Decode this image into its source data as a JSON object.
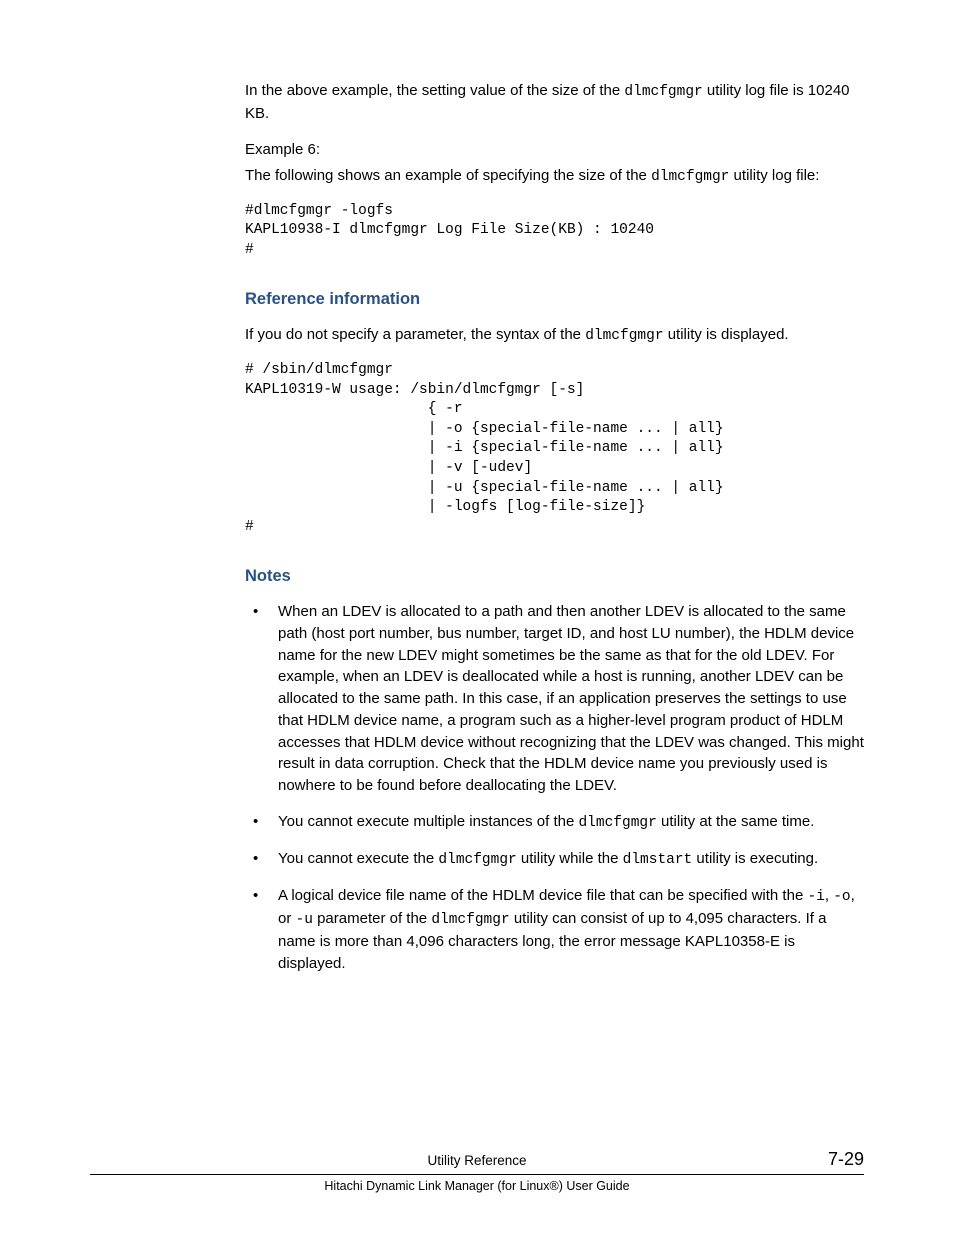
{
  "intro": {
    "p1_a": "In the above example, the setting value of the size of the ",
    "p1_code": "dlmcfgmgr",
    "p1_b": " utility log file is 10240 KB.",
    "example_label": "Example 6:",
    "p2_a": "The following shows an example of specifying the size of the ",
    "p2_code": "dlmcfgmgr",
    "p2_b": " utility log file:",
    "codeblock": "#dlmcfgmgr -logfs\nKAPL10938-I dlmcfgmgr Log File Size(KB) : 10240\n#"
  },
  "ref": {
    "heading": "Reference information",
    "p_a": "If you do not specify a parameter, the syntax of the ",
    "p_code": "dlmcfgmgr",
    "p_b": " utility is displayed.",
    "codeblock": "# /sbin/dlmcfgmgr\nKAPL10319-W usage: /sbin/dlmcfgmgr [-s]\n                     { -r\n                     | -o {special-file-name ... | all}\n                     | -i {special-file-name ... | all}\n                     | -v [-udev]\n                     | -u {special-file-name ... | all}\n                     | -logfs [log-file-size]}\n#"
  },
  "notes": {
    "heading": "Notes",
    "items": {
      "n1": "When an LDEV is allocated to a path and then another LDEV is allocated to the same path (host port number, bus number, target ID, and host LU number), the HDLM device name for the new LDEV might sometimes be the same as that for the old LDEV. For example, when an LDEV is deallocated while a host is running, another LDEV can be allocated to the same path. In this case, if an application preserves the settings to use that HDLM device name, a program such as a higher-level program product of HDLM accesses that HDLM device without recognizing that the LDEV was changed. This might result in data corruption. Check that the HDLM device name you previously used is nowhere to be found before deallocating the LDEV.",
      "n2_a": "You cannot execute multiple instances of the ",
      "n2_code": "dlmcfgmgr",
      "n2_b": " utility at the same time.",
      "n3_a": "You cannot execute the ",
      "n3_code1": "dlmcfgmgr",
      "n3_b": " utility while the ",
      "n3_code2": "dlmstart",
      "n3_c": " utility is executing.",
      "n4_a": "A logical device file name of the HDLM device file that can be specified with the ",
      "n4_code1": "-i",
      "n4_b": ", ",
      "n4_code2": "-o",
      "n4_c": ", or ",
      "n4_code3": "-u",
      "n4_d": " parameter of the ",
      "n4_code4": "dlmcfgmgr",
      "n4_e": " utility can consist of up to 4,095 characters. If a name is more than 4,096 characters long, the error message KAPL10358-E is displayed."
    }
  },
  "footer": {
    "section": "Utility Reference",
    "page": "7-29",
    "title": "Hitachi Dynamic Link Manager (for Linux®) User Guide"
  }
}
